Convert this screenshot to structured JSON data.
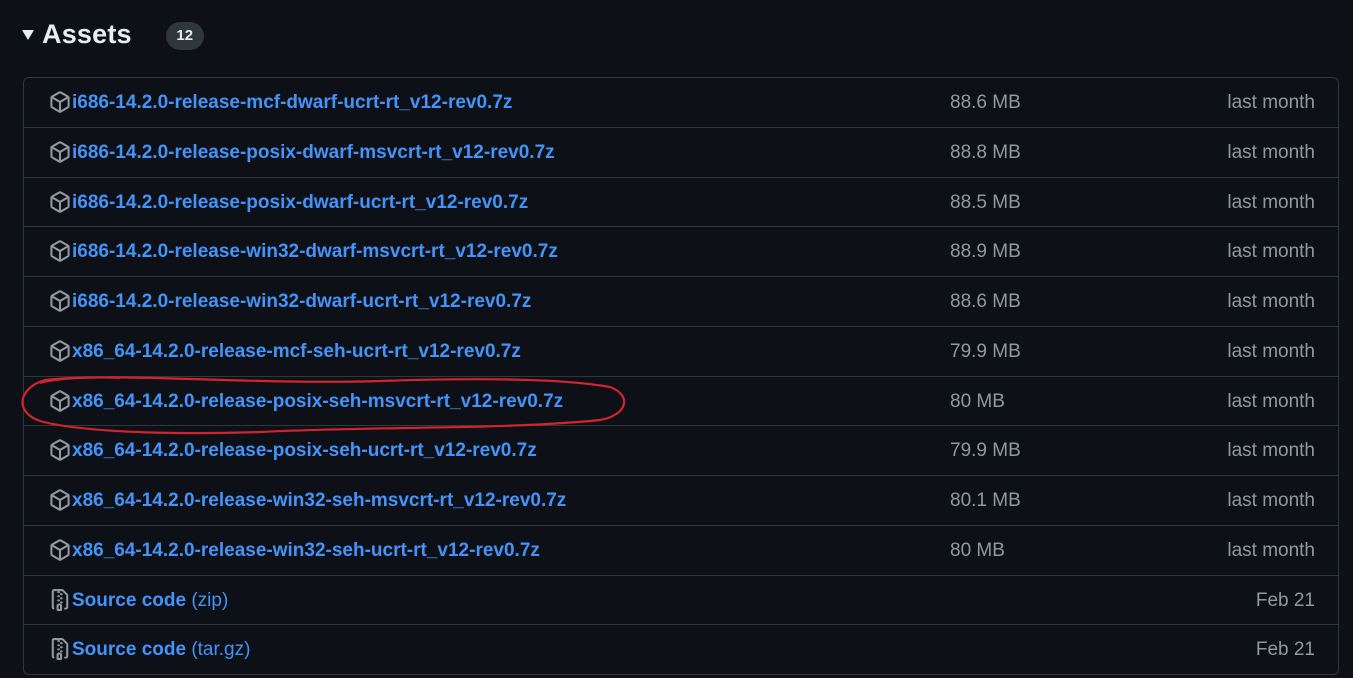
{
  "header": {
    "title": "Assets",
    "count": "12"
  },
  "colors": {
    "background": "#0d1117",
    "link": "#4493f8",
    "muted": "#9198a1",
    "border": "#30363d",
    "annotation": "#d1242f"
  },
  "assets": [
    {
      "name": "i686-14.2.0-release-mcf-dwarf-ucrt-rt_v12-rev0.7z",
      "size": "88.6 MB",
      "date": "last month",
      "icon": "package-icon"
    },
    {
      "name": "i686-14.2.0-release-posix-dwarf-msvcrt-rt_v12-rev0.7z",
      "size": "88.8 MB",
      "date": "last month",
      "icon": "package-icon"
    },
    {
      "name": "i686-14.2.0-release-posix-dwarf-ucrt-rt_v12-rev0.7z",
      "size": "88.5 MB",
      "date": "last month",
      "icon": "package-icon"
    },
    {
      "name": "i686-14.2.0-release-win32-dwarf-msvcrt-rt_v12-rev0.7z",
      "size": "88.9 MB",
      "date": "last month",
      "icon": "package-icon"
    },
    {
      "name": "i686-14.2.0-release-win32-dwarf-ucrt-rt_v12-rev0.7z",
      "size": "88.6 MB",
      "date": "last month",
      "icon": "package-icon"
    },
    {
      "name": "x86_64-14.2.0-release-mcf-seh-ucrt-rt_v12-rev0.7z",
      "size": "79.9 MB",
      "date": "last month",
      "icon": "package-icon"
    },
    {
      "name": "x86_64-14.2.0-release-posix-seh-msvcrt-rt_v12-rev0.7z",
      "size": "80 MB",
      "date": "last month",
      "icon": "package-icon"
    },
    {
      "name": "x86_64-14.2.0-release-posix-seh-ucrt-rt_v12-rev0.7z",
      "size": "79.9 MB",
      "date": "last month",
      "icon": "package-icon"
    },
    {
      "name": "x86_64-14.2.0-release-win32-seh-msvcrt-rt_v12-rev0.7z",
      "size": "80.1 MB",
      "date": "last month",
      "icon": "package-icon"
    },
    {
      "name": "x86_64-14.2.0-release-win32-seh-ucrt-rt_v12-rev0.7z",
      "size": "80 MB",
      "date": "last month",
      "icon": "package-icon"
    }
  ],
  "source_code": [
    {
      "name": "Source code",
      "suffix": "(zip)",
      "date": "Feb 21",
      "icon": "file-zip-icon"
    },
    {
      "name": "Source code",
      "suffix": "(tar.gz)",
      "date": "Feb 21",
      "icon": "file-zip-icon"
    }
  ]
}
